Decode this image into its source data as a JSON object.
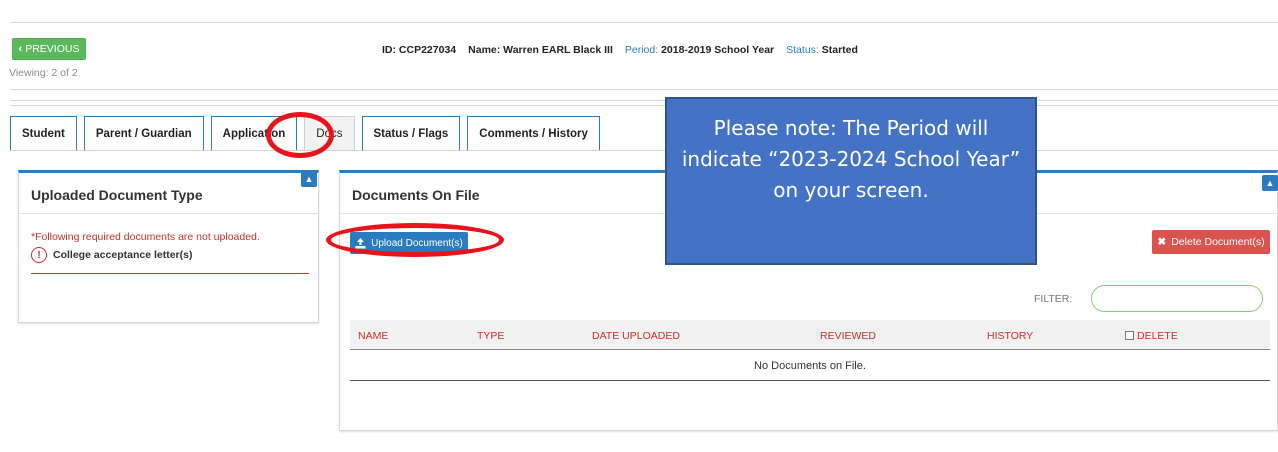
{
  "header": {
    "previous_label": "PREVIOUS",
    "viewing": "Viewing: 2 of 2",
    "id_label": "ID:",
    "id_value": "CCP227034",
    "name_label": "Name:",
    "name_value": "Warren EARL Black III",
    "period_label": "Period:",
    "period_value": "2018-2019 School Year",
    "status_label": "Status:",
    "status_value": "Started"
  },
  "tabs": [
    {
      "label": "Student"
    },
    {
      "label": "Parent / Guardian"
    },
    {
      "label": "Application"
    },
    {
      "label": "Docs",
      "active": true
    },
    {
      "label": "Status / Flags"
    },
    {
      "label": "Comments / History"
    }
  ],
  "left_panel": {
    "title": "Uploaded Document Type",
    "required_note": "*Following required documents are not uploaded.",
    "missing_items": [
      "College acceptance letter(s)"
    ]
  },
  "right_panel": {
    "title": "Documents On File",
    "upload_label": "Upload Document(s)",
    "delete_label": "Delete Document(s)",
    "filter_label": "FILTER:",
    "filter_value": "",
    "columns": [
      "NAME",
      "TYPE",
      "DATE UPLOADED",
      "REVIEWED",
      "HISTORY",
      "DELETE"
    ],
    "empty_message": "No Documents on File."
  },
  "note_callout": {
    "text": "Please note: The Period will indicate “2023-2024 School Year” on your screen."
  },
  "colors": {
    "accent": "#2a7bbf",
    "success": "#5cb85c",
    "danger": "#d9534f",
    "callout": "#4472c4",
    "annotation": "#e8141b"
  }
}
